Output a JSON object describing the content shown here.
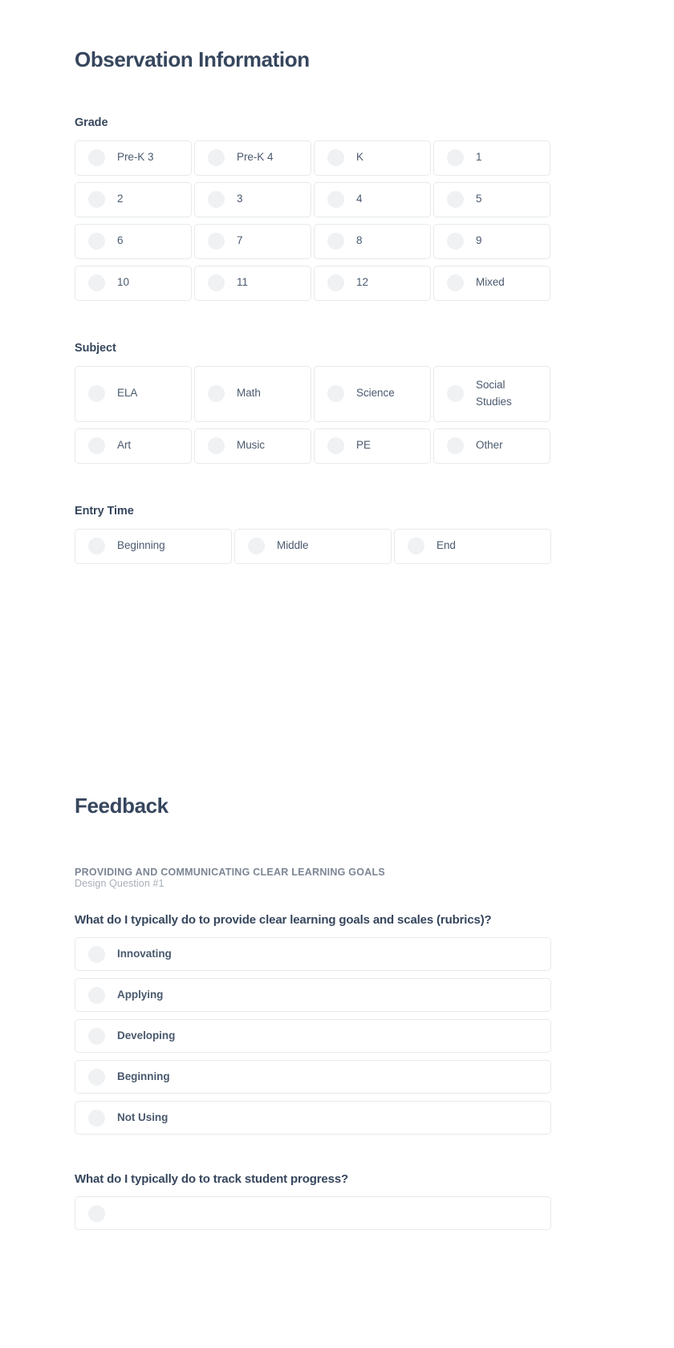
{
  "observation": {
    "title": "Observation Information",
    "groups": [
      {
        "label": "Grade",
        "layout": "grid-4",
        "options": [
          "Pre-K 3",
          "Pre-K 4",
          "K",
          "1",
          "2",
          "3",
          "4",
          "5",
          "6",
          "7",
          "8",
          "9",
          "10",
          "11",
          "12",
          "Mixed"
        ]
      },
      {
        "label": "Subject",
        "layout": "grid-subject",
        "options": [
          "ELA",
          "Math",
          "Science",
          "Social Studies",
          "Art",
          "Music",
          "PE",
          "Other"
        ]
      },
      {
        "label": "Entry Time",
        "layout": "grid-3",
        "options": [
          "Beginning",
          "Middle",
          "End"
        ]
      }
    ]
  },
  "feedback": {
    "title": "Feedback",
    "design_question": {
      "heading": "PROVIDING AND COMMUNICATING CLEAR LEARNING GOALS",
      "subheading": "Design Question #1"
    },
    "questions": [
      {
        "text": "What do I typically do to provide clear learning goals and scales (rubrics)?",
        "options": [
          "Innovating",
          "Applying",
          "Developing",
          "Beginning",
          "Not Using"
        ]
      },
      {
        "text": "What do I typically do to track student progress?",
        "options": []
      }
    ]
  },
  "colors": {
    "heading": "#36465d",
    "body_text": "#4b5a6e",
    "muted": "#7c8694",
    "faint": "#a8aeb7",
    "card_border": "#e7e9ec",
    "dot_fill": "#eff1f3",
    "background": "#ffffff"
  }
}
